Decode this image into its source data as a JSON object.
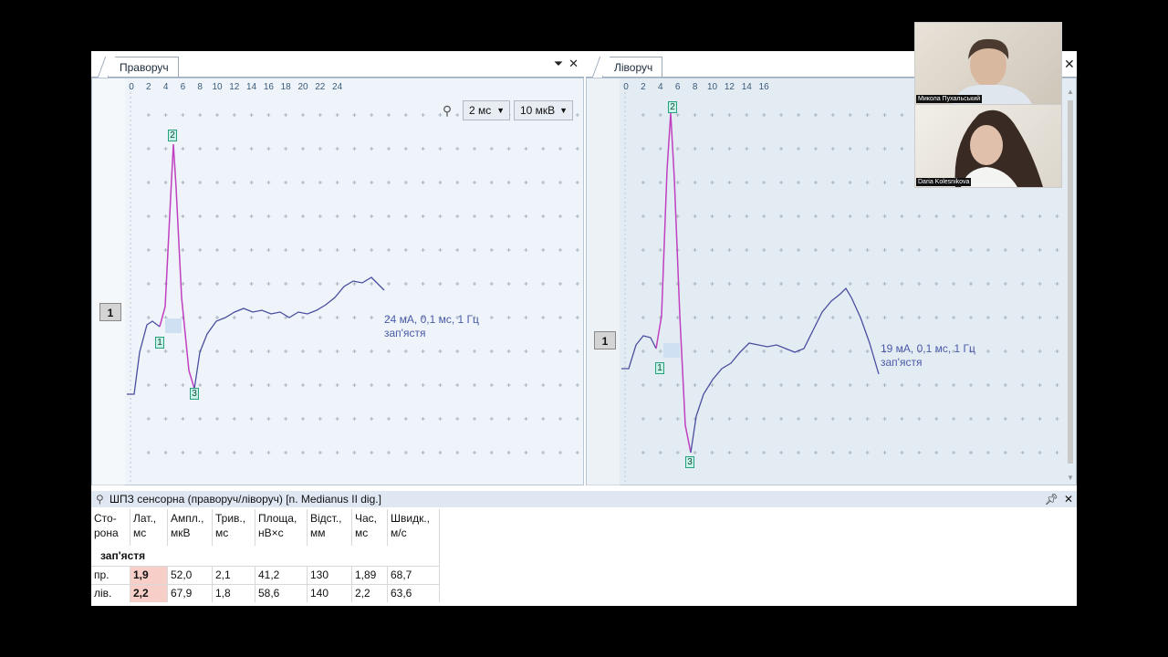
{
  "left_panel": {
    "tab_label": "Праворуч",
    "x_ticks": [
      "0",
      "2",
      "4",
      "6",
      "8",
      "10",
      "12",
      "14",
      "16",
      "18",
      "20",
      "22",
      "24"
    ],
    "time_scale": "2 мс",
    "amp_scale": "10 мкВ",
    "channel": "1",
    "markers": [
      "1",
      "2",
      "3"
    ],
    "stim_line1": "24 мА, 0,1 мс, 1 Гц",
    "stim_line2": "зап'ястя"
  },
  "right_panel": {
    "tab_label": "Ліворуч",
    "x_ticks": [
      "0",
      "2",
      "4",
      "6",
      "8",
      "10",
      "12",
      "14",
      "16"
    ],
    "channel": "1",
    "markers": [
      "1",
      "2",
      "3"
    ],
    "stim_line1": "19 мА, 0,1 мс, 1 Гц",
    "stim_line2": "зап'ястя"
  },
  "results": {
    "title": "ШПЗ сенсорна (праворуч/ліворуч) [n. Medianus II dig.]",
    "headers": [
      [
        "Сто-",
        "рона"
      ],
      [
        "Лат.,",
        "мс"
      ],
      [
        "Ампл.,",
        "мкВ"
      ],
      [
        "Трив.,",
        "мс"
      ],
      [
        "Площа,",
        "нВ×с"
      ],
      [
        "Відст.,",
        "мм"
      ],
      [
        "Час,",
        "мс"
      ],
      [
        "Швидк.,",
        "м/с"
      ]
    ],
    "section": "зап'ястя",
    "rows": [
      [
        "пр.",
        "1,9",
        "52,0",
        "2,1",
        "41,2",
        "130",
        "1,89",
        "68,7"
      ],
      [
        "лів.",
        "2,2",
        "67,9",
        "1,8",
        "58,6",
        "140",
        "2,2",
        "63,6"
      ]
    ]
  },
  "participants": [
    {
      "name": "Микола Пухальський"
    },
    {
      "name": "Daria Kolesnikova"
    }
  ],
  "colors": {
    "trace": "#4a4ea0",
    "response": "#c040c0",
    "plot_bg_left": "#eef4f9",
    "plot_bg_right": "#e4ecf3",
    "latency_highlight": "#f7cfc8"
  }
}
